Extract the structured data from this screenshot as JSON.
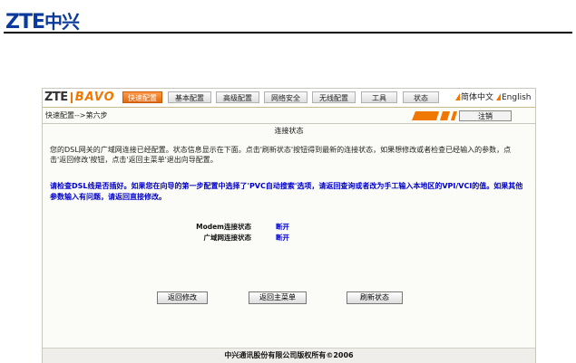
{
  "doc_logo": {
    "latin": "ZTE",
    "han": "中兴"
  },
  "brand": {
    "zte": "ZTE",
    "bavo": "BAVO"
  },
  "nav": {
    "tabs": [
      {
        "label": "快速配置",
        "active": true
      },
      {
        "label": "基本配置",
        "active": false
      },
      {
        "label": "高级配置",
        "active": false
      },
      {
        "label": "网络安全",
        "active": false
      },
      {
        "label": "无线配置",
        "active": false
      },
      {
        "label": "工具",
        "active": false
      },
      {
        "label": "状态",
        "active": false
      }
    ],
    "lang_cn": "简体中文",
    "lang_en": "English"
  },
  "breadcrumb": "快速配置-->第六步",
  "exit_label": "注销",
  "page_title": "连接状态",
  "description": "您的DSL网关的广域网连接已经配置。状态信息显示在下面。点击'刷新状态'按钮得到最新的连接状态，如果想修改或者检查已经输入的参数，点击'返回修改'按钮，点击'返回主菜单'退出向导配置。",
  "warning": "请检查DSL线是否插好。如果您在向导的第一步配置中选择了'PVC自动搜索'选项，请返回查询或者改为手工输入本地区的VPI/VCI的值。如果其他参数输入有问题，请返回直接修改。",
  "status_rows": [
    {
      "label": "Modem连接状态",
      "value": "断开"
    },
    {
      "label": "广域网连接状态",
      "value": "断开"
    }
  ],
  "buttons": {
    "back_modify": "返回修改",
    "back_main": "返回主菜单",
    "refresh": "刷新状态"
  },
  "footer": "中兴通讯股份有限公司版权所有©2006",
  "colors": {
    "accent": "#f07800",
    "link_blue": "#0000c8",
    "logo_blue": "#0a3a9c"
  }
}
